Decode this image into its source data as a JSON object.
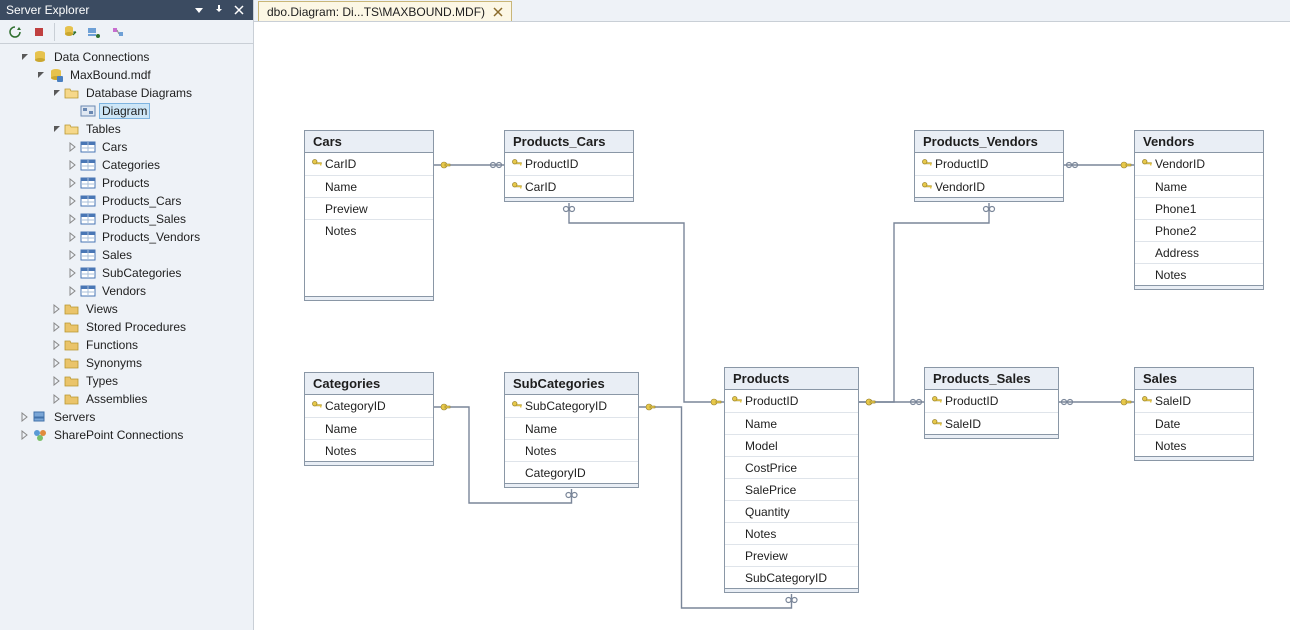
{
  "explorer": {
    "title": "Server Explorer",
    "nodes": {
      "data_connections": "Data Connections",
      "maxbound": "MaxBound.mdf",
      "db_diagrams": "Database Diagrams",
      "diagram": "Diagram",
      "tables": "Tables",
      "t_cars": "Cars",
      "t_categories": "Categories",
      "t_products": "Products",
      "t_products_cars": "Products_Cars",
      "t_products_sales": "Products_Sales",
      "t_products_vendors": "Products_Vendors",
      "t_sales": "Sales",
      "t_subcategories": "SubCategories",
      "t_vendors": "Vendors",
      "views": "Views",
      "stored_procedures": "Stored Procedures",
      "functions": "Functions",
      "synonyms": "Synonyms",
      "types": "Types",
      "assemblies": "Assemblies",
      "servers": "Servers",
      "sharepoint": "SharePoint Connections"
    }
  },
  "tab": {
    "label": "dbo.Diagram: Di...TS\\MAXBOUND.MDF)"
  },
  "tables": {
    "Cars": {
      "title": "Cars",
      "cols": [
        {
          "name": "CarID",
          "pk": true
        },
        {
          "name": "Name",
          "pk": false
        },
        {
          "name": "Preview",
          "pk": false
        },
        {
          "name": "Notes",
          "pk": false
        }
      ]
    },
    "Products_Cars": {
      "title": "Products_Cars",
      "cols": [
        {
          "name": "ProductID",
          "pk": true
        },
        {
          "name": "CarID",
          "pk": true
        }
      ]
    },
    "Products_Vendors": {
      "title": "Products_Vendors",
      "cols": [
        {
          "name": "ProductID",
          "pk": true
        },
        {
          "name": "VendorID",
          "pk": true
        }
      ]
    },
    "Vendors": {
      "title": "Vendors",
      "cols": [
        {
          "name": "VendorID",
          "pk": true
        },
        {
          "name": "Name",
          "pk": false
        },
        {
          "name": "Phone1",
          "pk": false
        },
        {
          "name": "Phone2",
          "pk": false
        },
        {
          "name": "Address",
          "pk": false
        },
        {
          "name": "Notes",
          "pk": false
        }
      ]
    },
    "Categories": {
      "title": "Categories",
      "cols": [
        {
          "name": "CategoryID",
          "pk": true
        },
        {
          "name": "Name",
          "pk": false
        },
        {
          "name": "Notes",
          "pk": false
        }
      ]
    },
    "SubCategories": {
      "title": "SubCategories",
      "cols": [
        {
          "name": "SubCategoryID",
          "pk": true
        },
        {
          "name": "Name",
          "pk": false
        },
        {
          "name": "Notes",
          "pk": false
        },
        {
          "name": "CategoryID",
          "pk": false
        }
      ]
    },
    "Products": {
      "title": "Products",
      "cols": [
        {
          "name": "ProductID",
          "pk": true
        },
        {
          "name": "Name",
          "pk": false
        },
        {
          "name": "Model",
          "pk": false
        },
        {
          "name": "CostPrice",
          "pk": false
        },
        {
          "name": "SalePrice",
          "pk": false
        },
        {
          "name": "Quantity",
          "pk": false
        },
        {
          "name": "Notes",
          "pk": false
        },
        {
          "name": "Preview",
          "pk": false
        },
        {
          "name": "SubCategoryID",
          "pk": false
        }
      ]
    },
    "Products_Sales": {
      "title": "Products_Sales",
      "cols": [
        {
          "name": "ProductID",
          "pk": true
        },
        {
          "name": "SaleID",
          "pk": true
        }
      ]
    },
    "Sales": {
      "title": "Sales",
      "cols": [
        {
          "name": "SaleID",
          "pk": true
        },
        {
          "name": "Date",
          "pk": false
        },
        {
          "name": "Notes",
          "pk": false
        }
      ]
    }
  }
}
